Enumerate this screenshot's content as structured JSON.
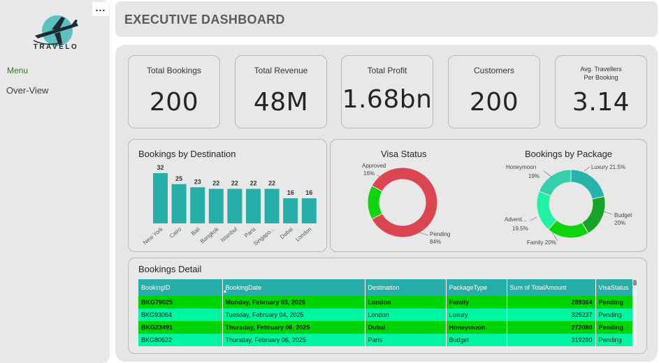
{
  "sidebar": {
    "more_label": "...",
    "logo_text": "TRAVELO",
    "menu_label": "Menu",
    "nav_items": [
      {
        "label": "Over-View"
      }
    ]
  },
  "header": {
    "title": "EXECUTIVE DASHBOARD"
  },
  "kpis": [
    {
      "label": "Total Bookings",
      "value": "200"
    },
    {
      "label": "Total Revenue",
      "value": "48M"
    },
    {
      "label": "Total Profit",
      "value": "1.68bn"
    },
    {
      "label": "Customers",
      "value": "200"
    },
    {
      "label_line1": "Avg. Travellers",
      "label_line2": "Per Booking",
      "value": "3.14"
    }
  ],
  "colors": {
    "teal": "#26ada8",
    "visa_approved": "#11d411",
    "visa_pending": "#db4551",
    "pkg_luxury": "#27b3a9",
    "pkg_budget": "#17a32a",
    "pkg_family": "#0dd40d",
    "pkg_adventure": "#20f2a3",
    "pkg_honeymoon": "#35cfac",
    "row_even": "#00d400",
    "row_odd": "#00f5a0"
  },
  "chart_data": [
    {
      "type": "bar",
      "title": "Bookings by Destination",
      "categories": [
        "New York",
        "Cairo",
        "Bali",
        "Bangkok",
        "Istanbul",
        "Paris",
        "Singapo...",
        "Dubai",
        "London"
      ],
      "values": [
        32,
        25,
        23,
        22,
        22,
        22,
        22,
        16,
        16
      ],
      "ylim": [
        0,
        32
      ],
      "grid": false
    },
    {
      "type": "pie",
      "title": "Visa Status",
      "donut": true,
      "categories": [
        "Approved",
        "Pending"
      ],
      "values": [
        16,
        84
      ],
      "labels": [
        "16%",
        "84%"
      ]
    },
    {
      "type": "pie",
      "title": "Bookings by Package",
      "donut": true,
      "categories": [
        "Luxury",
        "Budget",
        "Family",
        "Advent...",
        "Honeymoon"
      ],
      "values": [
        21.5,
        20,
        20,
        19.5,
        19
      ],
      "labels": [
        "21.5%",
        "20%",
        "20%",
        "19.5%",
        "19%"
      ]
    }
  ],
  "table": {
    "title": "Bookings Detail",
    "sort_indicator": "▲",
    "columns": [
      "BookingID",
      "BookingDate",
      "Destination",
      "PackageType",
      "Sum of TotalAmount",
      "VisaStatus"
    ],
    "rows": [
      [
        "BKG79025",
        "Monday, February 03, 2025",
        "London",
        "Family",
        "289364",
        "Pending"
      ],
      [
        "BKG93064",
        "Tuesday, February 04, 2025",
        "London",
        "Luxury",
        "329237",
        "Pending"
      ],
      [
        "BKG23491",
        "Thursday, February 06, 2025",
        "Dubai",
        "Honeymoon",
        "272080",
        "Pending"
      ],
      [
        "BKG80622",
        "Thursday, February 06, 2025",
        "Paris",
        "Budget",
        "319290",
        "Pending"
      ]
    ]
  }
}
